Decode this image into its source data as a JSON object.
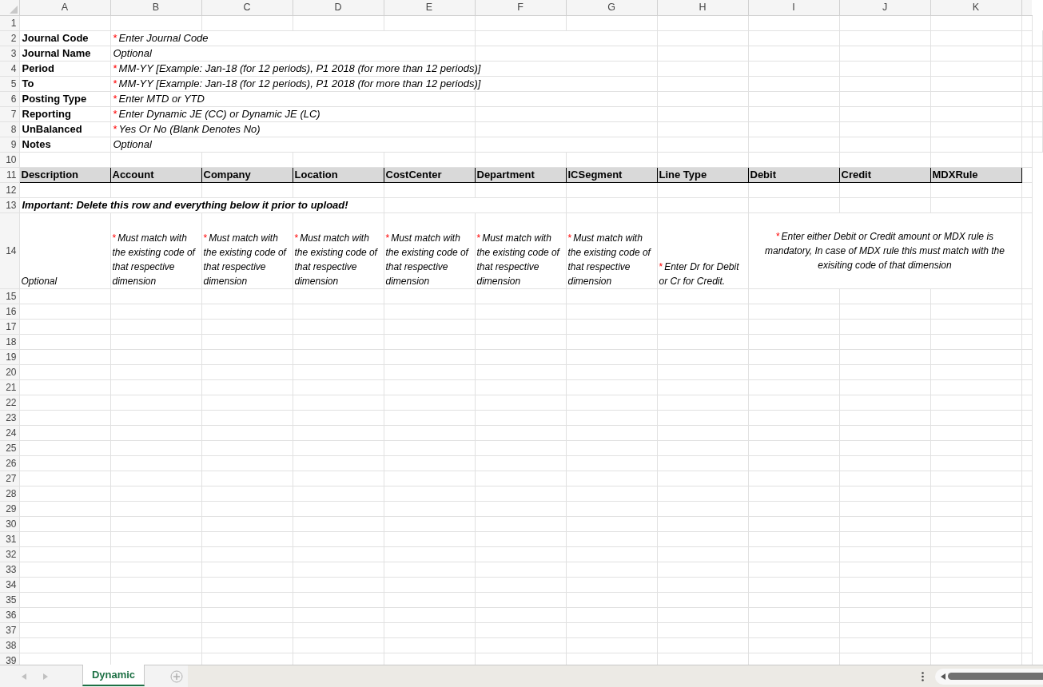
{
  "column_headers": [
    "A",
    "B",
    "C",
    "D",
    "E",
    "F",
    "G",
    "H",
    "I",
    "J",
    "K"
  ],
  "row_numbers": [
    "1",
    "2",
    "3",
    "4",
    "5",
    "6",
    "7",
    "8",
    "9",
    "10",
    "11",
    "12",
    "13",
    "14",
    "15",
    "16",
    "17",
    "18",
    "19",
    "20",
    "21",
    "22",
    "23",
    "24",
    "25",
    "26",
    "27",
    "28",
    "29",
    "30",
    "31",
    "32",
    "33",
    "34",
    "35",
    "36",
    "37",
    "38",
    "39"
  ],
  "fields": [
    {
      "label": "Journal Code",
      "asterisk": "*",
      "hint": "Enter Journal Code"
    },
    {
      "label": "Journal Name",
      "hint": "Optional"
    },
    {
      "label": "Period",
      "asterisk": "*",
      "hint": "MM-YY [Example: Jan-18 (for 12 periods), P1 2018 (for more than 12 periods)]"
    },
    {
      "label": "To",
      "asterisk": "*",
      "hint": "MM-YY [Example: Jan-18 (for 12 periods), P1 2018 (for more than 12 periods)]"
    },
    {
      "label": "Posting Type",
      "asterisk": "*",
      "hint": "Enter MTD or YTD"
    },
    {
      "label": "Reporting",
      "asterisk": "*",
      "hint": "Enter Dynamic JE (CC) or Dynamic JE (LC)"
    },
    {
      "label": "UnBalanced",
      "asterisk": "*",
      "hint": "Yes Or No (Blank Denotes No)"
    },
    {
      "label": "Notes",
      "hint": "Optional"
    }
  ],
  "table_header": [
    "Description",
    "Account",
    "Company",
    "Location",
    "CostCenter",
    "Department",
    "ICSegment",
    "Line Type",
    "Debit",
    "Credit",
    "MDXRule"
  ],
  "notice": "Important: Delete this row and everything below it prior to upload!",
  "hint_row": [
    {
      "kind": "cell",
      "text": "Optional"
    },
    {
      "kind": "cell",
      "asterisk": "*",
      "text": "Must match with the existing code of that respective dimension"
    },
    {
      "kind": "cell",
      "asterisk": "*",
      "text": "Must match with the existing code of that respective dimension"
    },
    {
      "kind": "cell",
      "asterisk": "*",
      "text": "Must match with the existing code of that respective dimension"
    },
    {
      "kind": "cell",
      "asterisk": "*",
      "text": "Must match with the existing code of that respective dimension"
    },
    {
      "kind": "cell",
      "asterisk": "*",
      "text": "Must match with the existing code of that respective dimension"
    },
    {
      "kind": "cell",
      "asterisk": "*",
      "text": "Must match with the existing code of that respective dimension"
    },
    {
      "kind": "cell",
      "asterisk": "*",
      "text": "Enter Dr for Debit or Cr for Credit."
    },
    {
      "kind": "merged",
      "asterisk": "*",
      "text": "Enter either Debit or Credit amount or MDX rule is mandatory, In case of MDX rule this must match with the exisiting code of that dimension"
    }
  ],
  "sheet_tabs": [
    {
      "label": "Dynamic",
      "selected": true
    }
  ]
}
